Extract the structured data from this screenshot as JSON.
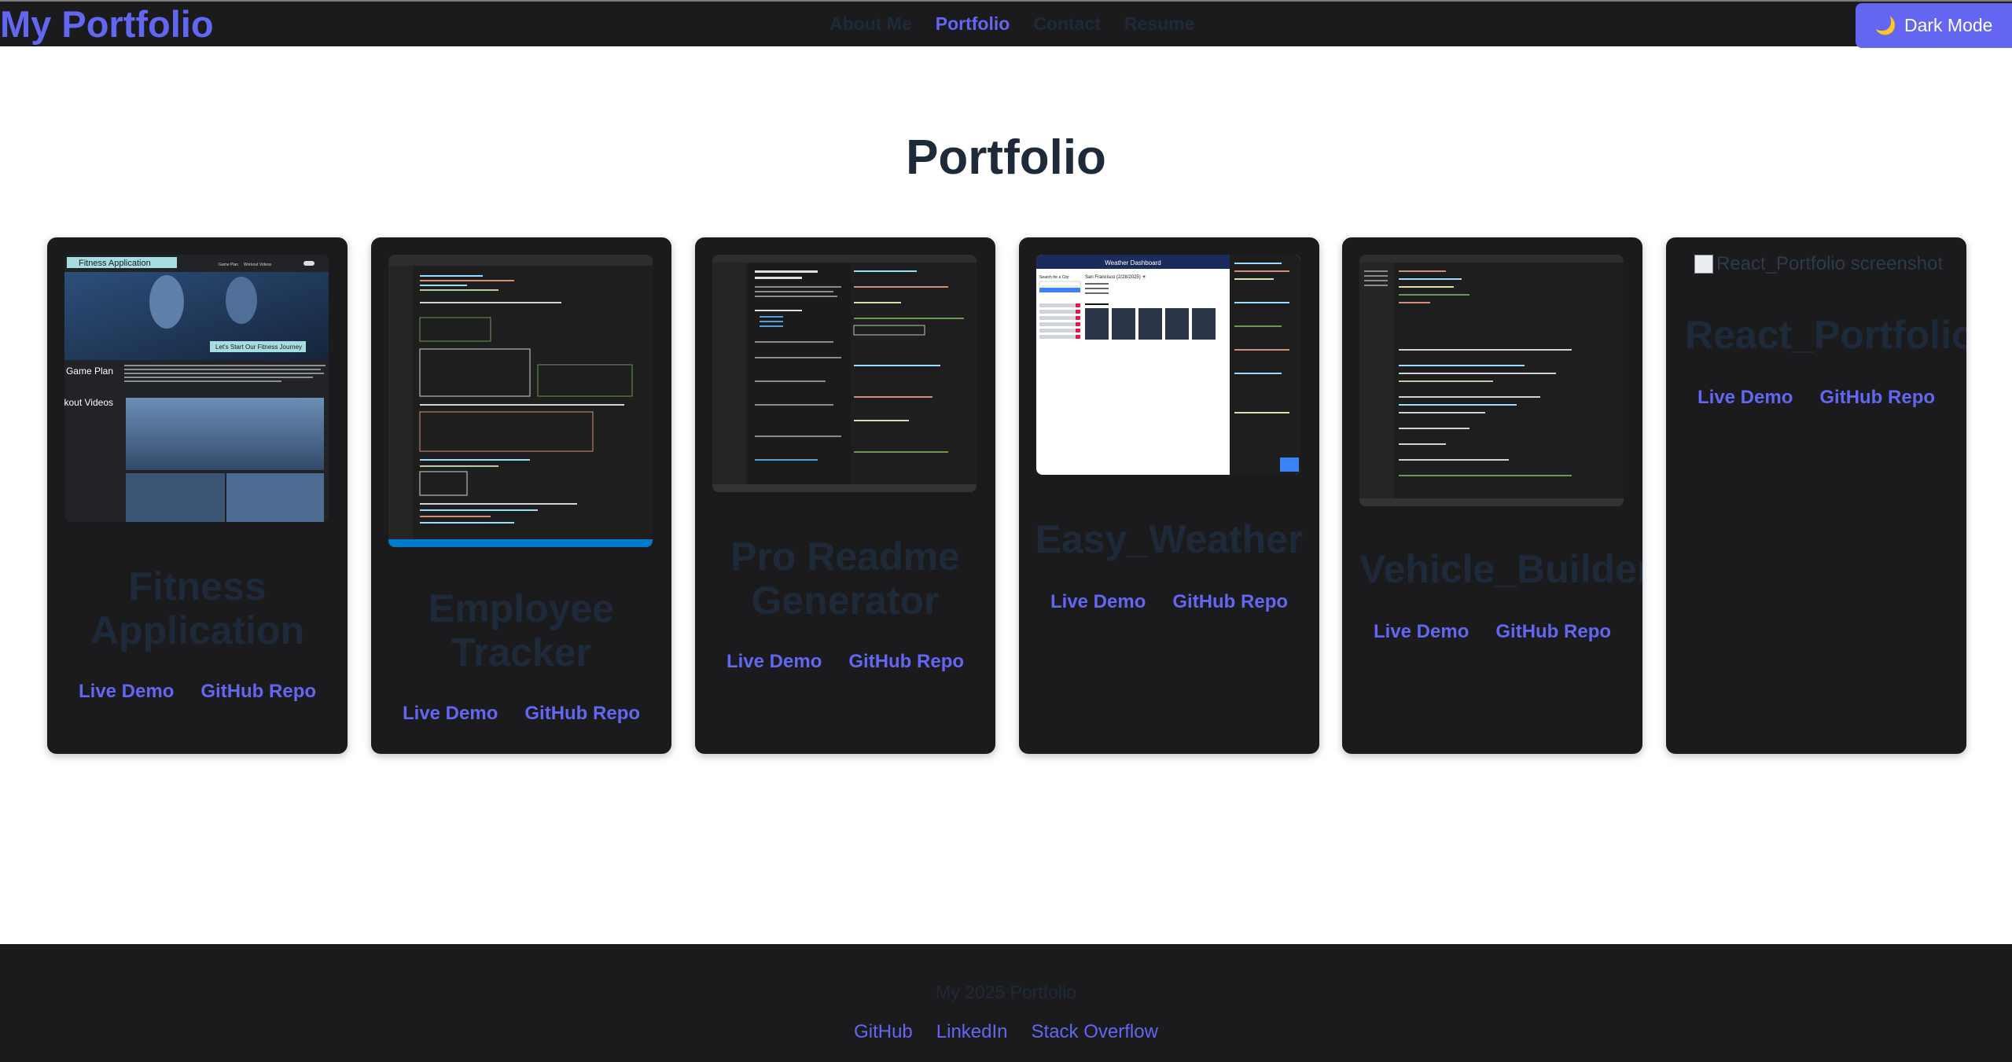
{
  "navbar": {
    "brand": "My Portfolio",
    "links": [
      {
        "label": "About Me",
        "active": false
      },
      {
        "label": "Portfolio",
        "active": true
      },
      {
        "label": "Contact",
        "active": false
      },
      {
        "label": "Resume",
        "active": false
      }
    ],
    "dark_mode_label": "Dark Mode",
    "dark_mode_icon": "moon-icon"
  },
  "main": {
    "title": "Portfolio",
    "projects": [
      {
        "title": "Fitness Application",
        "demo_label": "Live Demo",
        "repo_label": "GitHub Repo",
        "screenshot": {
          "header": "Fitness Application",
          "nav": [
            "Game Plan",
            "Workout Videos"
          ],
          "banner": "Let's Start Our Fitness Journey",
          "side": [
            "Game Plan",
            "Workout Videos"
          ]
        }
      },
      {
        "title": "Employee Tracker",
        "demo_label": "Live Demo",
        "repo_label": "GitHub Repo"
      },
      {
        "title": "Pro Readme Generator",
        "demo_label": "Live Demo",
        "repo_label": "GitHub Repo"
      },
      {
        "title": "Easy_Weather",
        "demo_label": "Live Demo",
        "repo_label": "GitHub Repo",
        "screenshot": {
          "header": "Weather Dashboard",
          "search_label": "Search for a City:",
          "city_heading": "San Francisco (2/28/2025) ☀"
        }
      },
      {
        "title": "Vehicle_Builder_a",
        "demo_label": "Live Demo",
        "repo_label": "GitHub Repo"
      },
      {
        "title": "React_Portfolio",
        "demo_label": "Live Demo",
        "repo_label": "GitHub Repo",
        "image_alt": "React_Portfolio screenshot"
      }
    ]
  },
  "footer": {
    "copyright": "My 2025 Portfolio",
    "links": [
      "GitHub",
      "LinkedIn",
      "Stack Overflow"
    ]
  },
  "colors": {
    "accent": "#6366f1",
    "dark": "#1b1b1d",
    "text_dark": "#1e2a3a"
  }
}
